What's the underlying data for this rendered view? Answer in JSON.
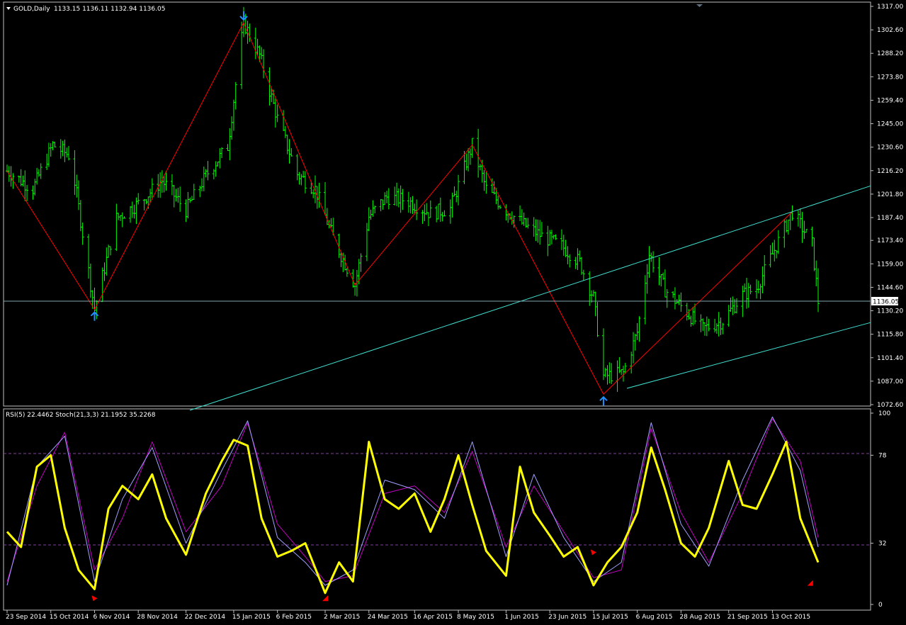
{
  "window": {
    "symbol_label": "GOLD,Daily",
    "ohlc": "1133.15 1136.11 1132.94 1136.05"
  },
  "price_pane": {
    "price_axis_ticks": [
      "1317.00",
      "1302.60",
      "1288.20",
      "1273.80",
      "1259.40",
      "1245.00",
      "1230.60",
      "1216.20",
      "1201.80",
      "1187.40",
      "1173.40",
      "1159.00",
      "1144.60",
      "1130.20",
      "1115.80",
      "1101.40",
      "1087.00",
      "1072.60"
    ],
    "current_price_label": "1136.05"
  },
  "indicator_pane": {
    "label": "RSI(5) 22.4462  Stoch(21,3,3) 21.1952 35.2268",
    "axis_ticks": [
      "100",
      "78",
      "32",
      "0"
    ]
  },
  "time_axis_ticks": [
    "23 Sep 2014",
    "15 Oct 2014",
    "6 Nov 2014",
    "28 Nov 2014",
    "22 Dec 2014",
    "15 Jan 2015",
    "6 Feb 2015",
    "2 Mar 2015",
    "24 Mar 2015",
    "16 Apr 2015",
    "8 May 2015",
    "1 Jun 2015",
    "23 Jun 2015",
    "15 Jul 2015",
    "6 Aug 2015",
    "28 Aug 2015",
    "21 Sep 2015",
    "13 Oct 2015"
  ],
  "colors": {
    "background": "#000000",
    "bar": "#00ff00",
    "zigzag": "#ff0000",
    "channel": "#40e0d0",
    "rsi": "#ffff00",
    "stoch_main": "#a0a0ff",
    "stoch_signal": "#c000c0",
    "arrow": "#1e90ff",
    "signal_marker": "#ff0000",
    "grid_text": "#ffffff"
  },
  "chart_data": [
    {
      "type": "line",
      "title": "GOLD,Daily",
      "ylim": [
        1072.6,
        1317.0
      ],
      "series": [
        {
          "name": "Zigzag",
          "x": [
            "23 Sep 2014",
            "6 Nov 2014",
            "20 Jan 2015",
            "17 Mar 2015",
            "15 May 2015",
            "20 Jul 2015",
            "23 Oct 2015"
          ],
          "y": [
            1216.0,
            1131.0,
            1307.0,
            1146.0,
            1232.0,
            1079.0,
            1191.0
          ]
        },
        {
          "name": "Channel upper",
          "x": [
            "23 Jul 2015",
            "23 Oct 2015"
          ],
          "y": [
            1154.0,
            1191.0
          ]
        },
        {
          "name": "Channel lower",
          "x": [
            "30 Jul 2015",
            "23 Oct 2015"
          ],
          "y": [
            1082.0,
            1110.0
          ]
        }
      ],
      "price_path": {
        "x": [
          "23 Sep 2014",
          "6 Oct 2014",
          "16 Oct 2014",
          "25 Oct 2014",
          "6 Nov 2014",
          "17 Nov 2014",
          "28 Nov 2014",
          "10 Dec 2014",
          "22 Dec 2014",
          "2 Jan 2015",
          "12 Jan 2015",
          "20 Jan 2015",
          "28 Jan 2015",
          "6 Feb 2015",
          "16 Feb 2015",
          "25 Feb 2015",
          "6 Mar 2015",
          "17 Mar 2015",
          "24 Mar 2015",
          "2 Apr 2015",
          "12 Apr 2015",
          "24 Apr 2015",
          "4 May 2015",
          "15 May 2015",
          "22 May 2015",
          "1 Jun 2015",
          "10 Jun 2015",
          "19 Jun 2015",
          "29 Jun 2015",
          "8 Jul 2015",
          "15 Jul 2015",
          "20 Jul 2015",
          "30 Jul 2015",
          "6 Aug 2015",
          "12 Aug 2015",
          "20 Aug 2015",
          "28 Aug 2015",
          "8 Sep 2015",
          "18 Sep 2015",
          "28 Sep 2015",
          "5 Oct 2015",
          "13 Oct 2015",
          "23 Oct 2015",
          "2 Nov 2015",
          "5 Nov 2015"
        ],
        "y": [
          1216,
          1205,
          1232,
          1225,
          1131,
          1187,
          1196,
          1210,
          1192,
          1215,
          1231,
          1307,
          1287,
          1248,
          1214,
          1205,
          1175,
          1146,
          1188,
          1200,
          1198,
          1190,
          1193,
          1232,
          1205,
          1192,
          1183,
          1176,
          1170,
          1160,
          1138,
          1090,
          1092,
          1117,
          1165,
          1143,
          1133,
          1119,
          1124,
          1140,
          1144,
          1165,
          1191,
          1171,
          1136
        ]
      }
    },
    {
      "type": "line",
      "title": "RSI(5) 22.4462  Stoch(21,3,3) 21.1952 35.2268",
      "ylim": [
        0,
        100
      ],
      "levels": [
        78,
        32
      ],
      "series": [
        {
          "name": "RSI(5)",
          "x": [
            "23 Sep 2014",
            "30 Sep 2014",
            "8 Oct 2014",
            "15 Oct 2014",
            "22 Oct 2014",
            "29 Oct 2014",
            "6 Nov 2014",
            "13 Nov 2014",
            "20 Nov 2014",
            "28 Nov 2014",
            "5 Dec 2014",
            "12 Dec 2014",
            "22 Dec 2014",
            "1 Jan 2015",
            "9 Jan 2015",
            "15 Jan 2015",
            "22 Jan 2015",
            "29 Jan 2015",
            "6 Feb 2015",
            "13 Feb 2015",
            "20 Feb 2015",
            "2 Mar 2015",
            "9 Mar 2015",
            "16 Mar 2015",
            "24 Mar 2015",
            "1 Apr 2015",
            "8 Apr 2015",
            "16 Apr 2015",
            "24 Apr 2015",
            "1 May 2015",
            "8 May 2015",
            "15 May 2015",
            "22 May 2015",
            "1 Jun 2015",
            "8 Jun 2015",
            "15 Jun 2015",
            "23 Jun 2015",
            "30 Jun 2015",
            "7 Jul 2015",
            "15 Jul 2015",
            "22 Jul 2015",
            "29 Jul 2015",
            "6 Aug 2015",
            "13 Aug 2015",
            "20 Aug 2015",
            "28 Aug 2015",
            "4 Sep 2015",
            "11 Sep 2015",
            "21 Sep 2015",
            "28 Sep 2015",
            "5 Oct 2015",
            "13 Oct 2015",
            "20 Oct 2015",
            "27 Oct 2015",
            "5 Nov 2015"
          ],
          "values": [
            38,
            30,
            72,
            78,
            40,
            18,
            8,
            50,
            62,
            55,
            68,
            45,
            26,
            58,
            75,
            86,
            83,
            45,
            25,
            28,
            32,
            6,
            22,
            12,
            85,
            55,
            50,
            58,
            38,
            55,
            78,
            52,
            28,
            15,
            72,
            48,
            36,
            25,
            30,
            10,
            22,
            30,
            48,
            82,
            60,
            32,
            25,
            40,
            75,
            52,
            50,
            68,
            85,
            45,
            22
          ]
        },
        {
          "name": "Stoch main",
          "x": [
            "23 Sep 2014",
            "8 Oct 2014",
            "22 Oct 2014",
            "6 Nov 2014",
            "20 Nov 2014",
            "5 Dec 2014",
            "22 Dec 2014",
            "9 Jan 2015",
            "22 Jan 2015",
            "6 Feb 2015",
            "20 Feb 2015",
            "2 Mar 2015",
            "16 Mar 2015",
            "1 Apr 2015",
            "16 Apr 2015",
            "1 May 2015",
            "15 May 2015",
            "1 Jun 2015",
            "15 Jun 2015",
            "30 Jun 2015",
            "15 Jul 2015",
            "29 Jul 2015",
            "13 Aug 2015",
            "28 Aug 2015",
            "11 Sep 2015",
            "28 Sep 2015",
            "13 Oct 2015",
            "27 Oct 2015",
            "5 Nov 2015"
          ],
          "values": [
            10,
            72,
            88,
            12,
            55,
            82,
            32,
            70,
            96,
            35,
            22,
            10,
            18,
            65,
            60,
            45,
            85,
            25,
            68,
            35,
            12,
            22,
            95,
            42,
            20,
            65,
            98,
            70,
            30
          ]
        },
        {
          "name": "Stoch signal",
          "x": [
            "23 Sep 2014",
            "8 Oct 2014",
            "22 Oct 2014",
            "6 Nov 2014",
            "20 Nov 2014",
            "5 Dec 2014",
            "22 Dec 2014",
            "9 Jan 2015",
            "22 Jan 2015",
            "6 Feb 2015",
            "20 Feb 2015",
            "2 Mar 2015",
            "16 Mar 2015",
            "1 Apr 2015",
            "16 Apr 2015",
            "1 May 2015",
            "15 May 2015",
            "1 Jun 2015",
            "15 Jun 2015",
            "30 Jun 2015",
            "15 Jul 2015",
            "29 Jul 2015",
            "13 Aug 2015",
            "28 Aug 2015",
            "11 Sep 2015",
            "28 Sep 2015",
            "13 Oct 2015",
            "27 Oct 2015",
            "5 Nov 2015"
          ],
          "values": [
            12,
            62,
            90,
            18,
            45,
            85,
            38,
            62,
            95,
            42,
            25,
            12,
            15,
            58,
            62,
            48,
            80,
            30,
            62,
            38,
            14,
            18,
            92,
            48,
            22,
            58,
            97,
            75,
            35
          ]
        }
      ]
    }
  ]
}
